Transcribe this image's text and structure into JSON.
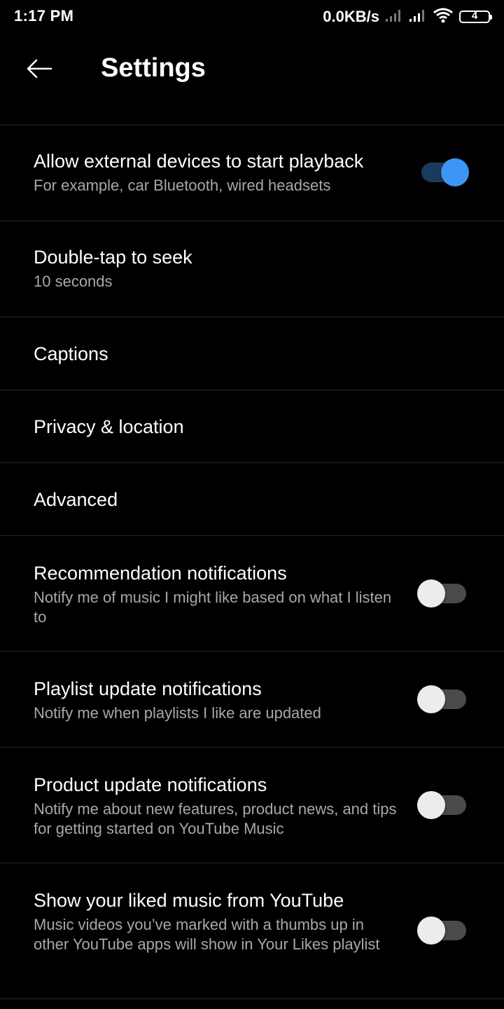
{
  "status_bar": {
    "time": "1:17 PM",
    "net_speed": "0.0KB/s",
    "battery_level": "4",
    "icons": [
      "signal-icon",
      "signal-icon",
      "wifi-icon",
      "battery-icon"
    ]
  },
  "header": {
    "back_icon": "arrow-left-icon",
    "title": "Settings"
  },
  "settings": {
    "external_devices": {
      "label": "Allow external devices to start playback",
      "sub": "For example, car Bluetooth, wired headsets",
      "enabled": true
    },
    "double_tap": {
      "label": "Double-tap to seek",
      "sub": "10 seconds"
    },
    "captions": {
      "label": "Captions"
    },
    "privacy": {
      "label": "Privacy & location"
    },
    "advanced": {
      "label": "Advanced"
    },
    "recommendation": {
      "label": "Recommendation notifications",
      "sub": "Notify me of music I might like based on what I listen to",
      "enabled": false
    },
    "playlist": {
      "label": "Playlist update notifications",
      "sub": "Notify me when playlists I like are updated",
      "enabled": false
    },
    "product": {
      "label": "Product update notifications",
      "sub": "Notify me about new features, product news, and tips for getting started on YouTube Music",
      "enabled": false
    },
    "liked_music": {
      "label": "Show your liked music from YouTube",
      "sub": "Music videos you’ve marked with a thumbs up in other YouTube apps will show in Your Likes playlist",
      "enabled": false
    }
  },
  "colors": {
    "background": "#000000",
    "accent": "#3d96f5",
    "secondary_text": "#a8a8a8",
    "divider": "#262626"
  }
}
